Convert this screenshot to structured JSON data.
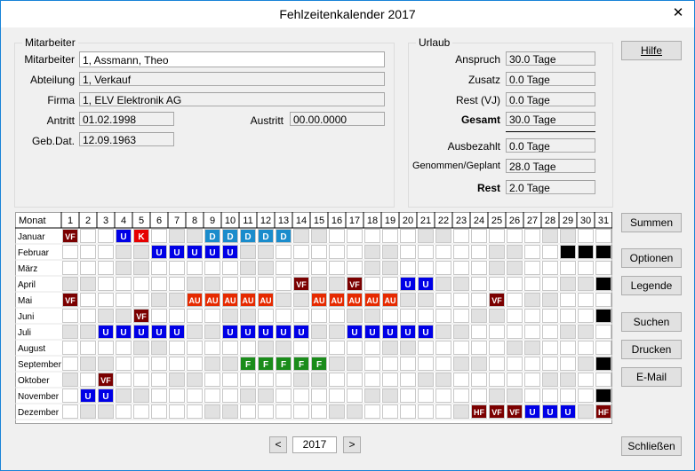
{
  "window": {
    "title": "Fehlzeitenkalender 2017",
    "close_glyph": "✕"
  },
  "mitarbeiter_group": {
    "title": "Mitarbeiter",
    "mitarbeiter_label": "Mitarbeiter",
    "mitarbeiter_value": "1, Assmann, Theo",
    "abteilung_label": "Abteilung",
    "abteilung_value": "1, Verkauf",
    "firma_label": "Firma",
    "firma_value": "1, ELV Elektronik AG",
    "antritt_label": "Antritt",
    "antritt_value": "01.02.1998",
    "austritt_label": "Austritt",
    "austritt_value": "00.00.0000",
    "gebdat_label": "Geb.Dat.",
    "gebdat_value": "12.09.1963"
  },
  "urlaub_group": {
    "title": "Urlaub",
    "anspruch_label": "Anspruch",
    "anspruch_value": "30.0 Tage",
    "zusatz_label": "Zusatz",
    "zusatz_value": "0.0 Tage",
    "rest_vj_label": "Rest (VJ)",
    "rest_vj_value": "0.0 Tage",
    "gesamt_label": "Gesamt",
    "gesamt_value": "30.0 Tage",
    "ausbezahlt_label": "Ausbezahlt",
    "ausbezahlt_value": "0.0 Tage",
    "genommen_label": "Genommen/Geplant",
    "genommen_value": "28.0 Tage",
    "rest_label": "Rest",
    "rest_value": "2.0 Tage"
  },
  "buttons": {
    "hilfe": "Hilfe",
    "summen": "Summen",
    "optionen": "Optionen",
    "legende": "Legende",
    "suchen": "Suchen",
    "drucken": "Drucken",
    "email": "E-Mail",
    "schliessen": "Schließen"
  },
  "year_nav": {
    "prev_glyph": "<",
    "year": "2017",
    "next_glyph": ">"
  },
  "colors": {
    "VF": "#7b0000",
    "K": "#e60000",
    "U": "#0000e6",
    "D": "#1a8ccc",
    "AU": "#e62a00",
    "F": "#1a8c1a",
    "HF": "#7b0000",
    "black": "#000000",
    "weekend": "#e1e1e1"
  },
  "calendar": {
    "month_header": "Monat",
    "days": [
      "1",
      "2",
      "3",
      "4",
      "5",
      "6",
      "7",
      "8",
      "9",
      "10",
      "11",
      "12",
      "13",
      "14",
      "15",
      "16",
      "17",
      "18",
      "19",
      "20",
      "21",
      "22",
      "23",
      "24",
      "25",
      "26",
      "27",
      "28",
      "29",
      "30",
      "31"
    ],
    "months": [
      {
        "name": "Januar",
        "days_in_month": 31,
        "weekends": [
          1,
          7,
          8,
          14,
          15,
          21,
          22,
          28,
          29
        ],
        "entries": [
          {
            "d": 1,
            "c": "VF"
          },
          {
            "d": 4,
            "c": "U"
          },
          {
            "d": 5,
            "c": "K"
          },
          {
            "d": 9,
            "c": "D"
          },
          {
            "d": 10,
            "c": "D"
          },
          {
            "d": 11,
            "c": "D"
          },
          {
            "d": 12,
            "c": "D"
          },
          {
            "d": 13,
            "c": "D"
          }
        ]
      },
      {
        "name": "Februar",
        "days_in_month": 28,
        "weekends": [
          4,
          5,
          11,
          12,
          18,
          19,
          25,
          26
        ],
        "entries": [
          {
            "d": 6,
            "c": "U"
          },
          {
            "d": 7,
            "c": "U"
          },
          {
            "d": 8,
            "c": "U"
          },
          {
            "d": 9,
            "c": "U"
          },
          {
            "d": 10,
            "c": "U"
          }
        ]
      },
      {
        "name": "März",
        "days_in_month": 31,
        "weekends": [
          4,
          5,
          11,
          12,
          18,
          19,
          25,
          26
        ],
        "entries": []
      },
      {
        "name": "April",
        "days_in_month": 30,
        "weekends": [
          1,
          2,
          8,
          9,
          15,
          16,
          22,
          23,
          29,
          30
        ],
        "entries": [
          {
            "d": 14,
            "c": "VF"
          },
          {
            "d": 17,
            "c": "VF"
          },
          {
            "d": 20,
            "c": "U"
          },
          {
            "d": 21,
            "c": "U"
          }
        ]
      },
      {
        "name": "Mai",
        "days_in_month": 31,
        "weekends": [
          6,
          7,
          13,
          14,
          20,
          21,
          27,
          28
        ],
        "entries": [
          {
            "d": 1,
            "c": "VF"
          },
          {
            "d": 8,
            "c": "AU"
          },
          {
            "d": 9,
            "c": "AU"
          },
          {
            "d": 10,
            "c": "AU"
          },
          {
            "d": 11,
            "c": "AU"
          },
          {
            "d": 12,
            "c": "AU"
          },
          {
            "d": 15,
            "c": "AU"
          },
          {
            "d": 16,
            "c": "AU"
          },
          {
            "d": 17,
            "c": "AU"
          },
          {
            "d": 18,
            "c": "AU"
          },
          {
            "d": 19,
            "c": "AU"
          },
          {
            "d": 25,
            "c": "VF"
          }
        ]
      },
      {
        "name": "Juni",
        "days_in_month": 30,
        "weekends": [
          3,
          4,
          10,
          11,
          17,
          18,
          24,
          25
        ],
        "entries": [
          {
            "d": 5,
            "c": "VF"
          }
        ]
      },
      {
        "name": "Juli",
        "days_in_month": 31,
        "weekends": [
          1,
          2,
          8,
          9,
          15,
          16,
          22,
          23,
          29,
          30
        ],
        "entries": [
          {
            "d": 3,
            "c": "U"
          },
          {
            "d": 4,
            "c": "U"
          },
          {
            "d": 5,
            "c": "U"
          },
          {
            "d": 6,
            "c": "U"
          },
          {
            "d": 7,
            "c": "U"
          },
          {
            "d": 10,
            "c": "U"
          },
          {
            "d": 11,
            "c": "U"
          },
          {
            "d": 12,
            "c": "U"
          },
          {
            "d": 13,
            "c": "U"
          },
          {
            "d": 14,
            "c": "U"
          },
          {
            "d": 17,
            "c": "U"
          },
          {
            "d": 18,
            "c": "U"
          },
          {
            "d": 19,
            "c": "U"
          },
          {
            "d": 20,
            "c": "U"
          },
          {
            "d": 21,
            "c": "U"
          }
        ]
      },
      {
        "name": "August",
        "days_in_month": 31,
        "weekends": [
          5,
          6,
          12,
          13,
          19,
          20,
          26,
          27
        ],
        "entries": []
      },
      {
        "name": "September",
        "days_in_month": 30,
        "weekends": [
          2,
          3,
          9,
          10,
          16,
          17,
          23,
          24,
          30
        ],
        "entries": [
          {
            "d": 11,
            "c": "F"
          },
          {
            "d": 12,
            "c": "F"
          },
          {
            "d": 13,
            "c": "F"
          },
          {
            "d": 14,
            "c": "F"
          },
          {
            "d": 15,
            "c": "F"
          }
        ]
      },
      {
        "name": "Oktober",
        "days_in_month": 31,
        "weekends": [
          1,
          7,
          8,
          14,
          15,
          21,
          22,
          28,
          29
        ],
        "entries": [
          {
            "d": 3,
            "c": "VF"
          }
        ]
      },
      {
        "name": "November",
        "days_in_month": 30,
        "weekends": [
          4,
          5,
          11,
          12,
          18,
          19,
          25,
          26
        ],
        "entries": [
          {
            "d": 2,
            "c": "U"
          },
          {
            "d": 3,
            "c": "U"
          }
        ]
      },
      {
        "name": "Dezember",
        "days_in_month": 31,
        "weekends": [
          2,
          3,
          9,
          10,
          16,
          17,
          23,
          30,
          31
        ],
        "entries": [
          {
            "d": 24,
            "c": "HF"
          },
          {
            "d": 25,
            "c": "VF"
          },
          {
            "d": 26,
            "c": "VF"
          },
          {
            "d": 27,
            "c": "U"
          },
          {
            "d": 28,
            "c": "U"
          },
          {
            "d": 29,
            "c": "U"
          },
          {
            "d": 31,
            "c": "HF"
          }
        ]
      }
    ]
  }
}
